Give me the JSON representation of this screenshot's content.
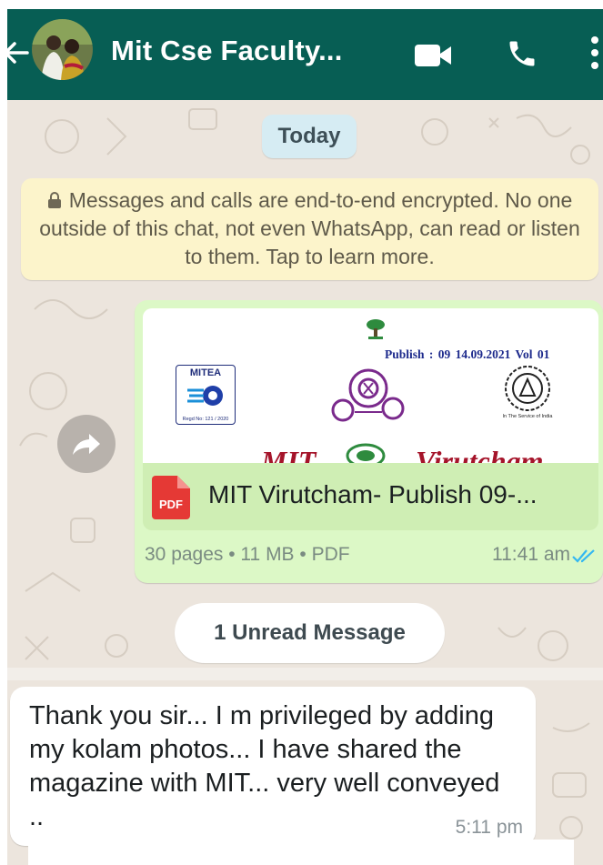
{
  "header": {
    "title": "Mit Cse Faculty...",
    "background": "#075e54",
    "icons": [
      "back-arrow-icon",
      "group-avatar",
      "video-call-icon",
      "phone-icon",
      "more-vert-icon"
    ]
  },
  "date_pill": "Today",
  "encryption_notice": {
    "text": "Messages and calls are end-to-end encrypted. No one outside of this chat, not even WhatsApp, can read or listen to them. Tap to learn more.",
    "icon": "lock-icon"
  },
  "outgoing_document": {
    "preview": {
      "publish_line": "Publish : 09   14.09.2021  Vol 01",
      "logo_text": "MITEA",
      "logo_caption": "Regd No: 121 / 2020",
      "seal_caption": "In The Service of India",
      "title_left": "MIT",
      "title_right": "Virutcham"
    },
    "file_type_label": "PDF",
    "file_name": "MIT Virutcham- Publish 09-...",
    "meta": "30 pages • 11 MB • PDF",
    "time": "11:41 am",
    "status": "read",
    "bubble_color": "#dcf8c6",
    "tick_color": "#34b7f1"
  },
  "unread_label": "1 Unread Message",
  "incoming_message": {
    "text": "Thank you sir... I m privileged by adding my kolam photos... I have shared the magazine with MIT... very well conveyed ..",
    "time": "5:11 pm"
  },
  "colors": {
    "chat_bg": "#ece5dd",
    "pdf_red": "#e53935",
    "date_pill": "#d6ecf3",
    "notice_bg": "#fcf4cb"
  }
}
